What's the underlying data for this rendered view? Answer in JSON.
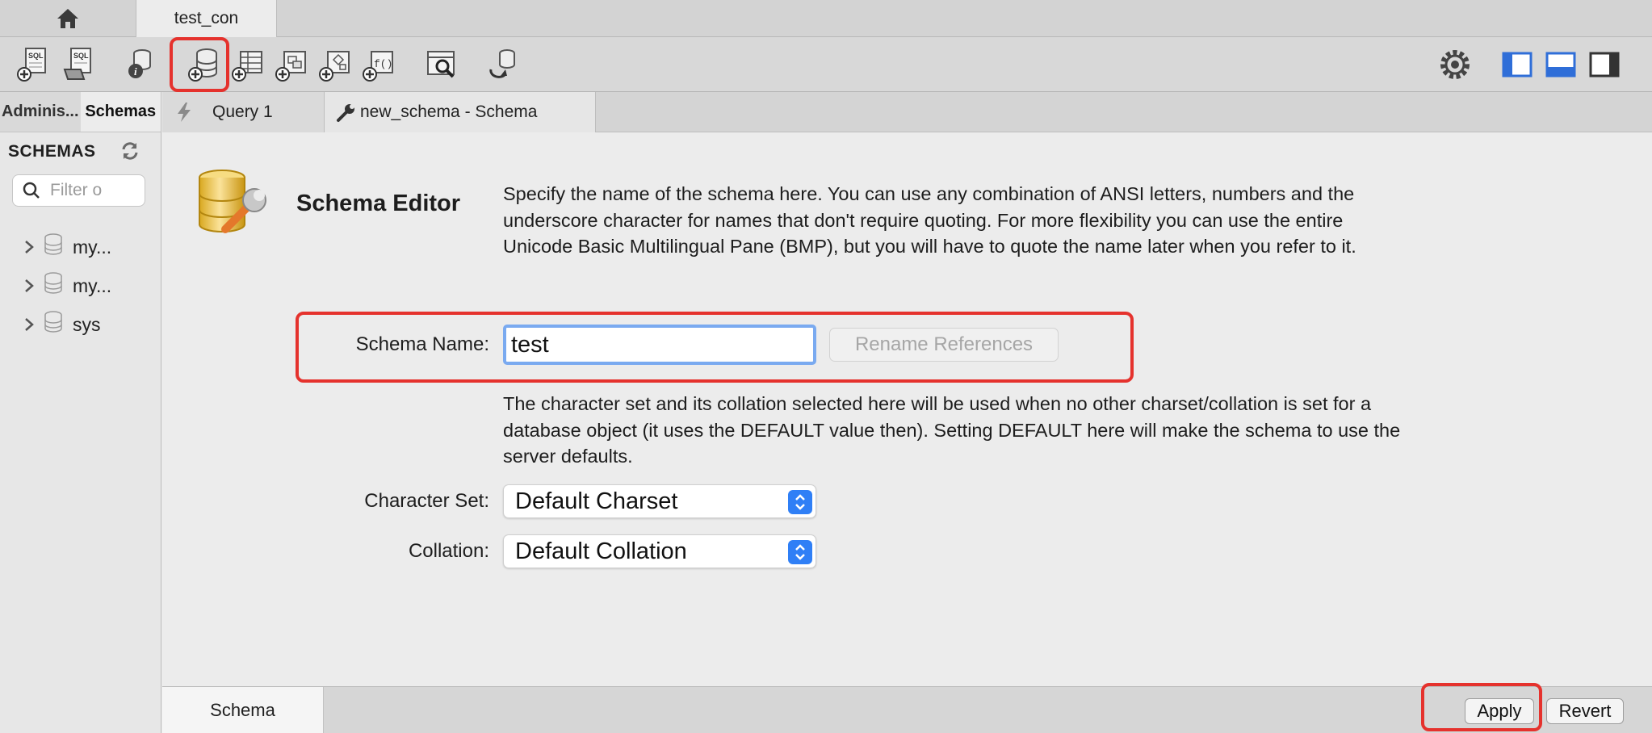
{
  "connection_tabs": {
    "home_icon": "home-icon",
    "active": "test_con"
  },
  "toolbar": {
    "buttons": [
      "new-sql-tab-icon",
      "open-sql-script-icon",
      "inspector-icon",
      "create-schema-icon",
      "create-table-icon",
      "create-view-icon",
      "create-procedure-icon",
      "create-function-icon",
      "search-table-data-icon",
      "reconnect-icon"
    ],
    "right_buttons": [
      "settings-gear-icon",
      "toggle-sidebar-icon",
      "toggle-output-icon",
      "toggle-secondary-sidebar-icon"
    ]
  },
  "sidebar": {
    "tabs": [
      "Adminis...",
      "Schemas"
    ],
    "active_tab": "Schemas",
    "heading": "SCHEMAS",
    "filter_placeholder": "Filter o",
    "schemas": [
      {
        "label": "my..."
      },
      {
        "label": "my..."
      },
      {
        "label": "sys"
      }
    ]
  },
  "editor_tabs": [
    {
      "label": "Query 1",
      "icon": "lightning-icon"
    },
    {
      "label": "new_schema - Schema",
      "icon": "wrench-icon"
    }
  ],
  "schema_editor": {
    "title": "Schema Editor",
    "intro_lines": [
      "Specify the name of the schema here. You can use any combination of ANSI letters, numbers and the",
      "underscore character for names that don't require quoting. For more flexibility you can use the entire",
      "Unicode Basic Multilingual Pane (BMP), but you will have to quote the name later when you refer to it."
    ],
    "schema_name_label": "Schema Name:",
    "schema_name_value": "test",
    "rename_button": "Rename References",
    "charset_lines": [
      "The character set and its collation selected here will be used when no other charset/collation is set for a",
      "database object (it uses the DEFAULT value then). Setting DEFAULT here will make the schema to use the",
      "server defaults."
    ],
    "charset_label": "Character Set:",
    "charset_value": "Default Charset",
    "collation_label": "Collation:",
    "collation_value": "Default Collation"
  },
  "bottom": {
    "tab": "Schema",
    "apply": "Apply",
    "revert": "Revert"
  },
  "colors": {
    "highlight": "#e5322d",
    "accent": "#2f7ff6",
    "focus_ring": "#7aaaf0"
  }
}
